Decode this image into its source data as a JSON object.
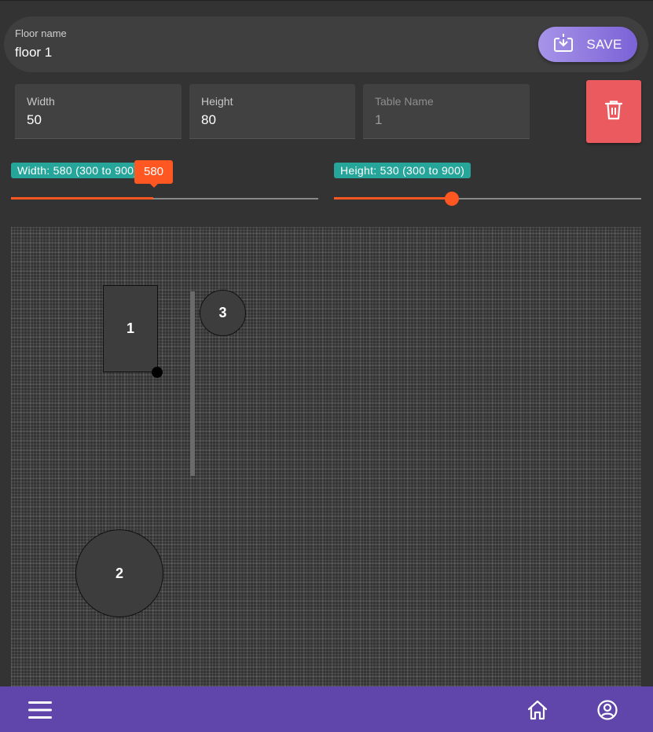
{
  "floor": {
    "label": "Floor name",
    "value": "floor 1"
  },
  "save_button": {
    "label": "SAVE",
    "icon": "download-save-icon"
  },
  "fields": {
    "width": {
      "label": "Width",
      "value": "50"
    },
    "height": {
      "label": "Height",
      "value": "80"
    },
    "table_name": {
      "label": "Table Name",
      "value": "1"
    }
  },
  "delete_button": {
    "icon": "trash-icon",
    "color": "#eb5a5f"
  },
  "sliders": {
    "width": {
      "badge": "Width: 580 (300 to 900)",
      "value": 580,
      "min": 300,
      "max": 900,
      "tooltip": "580"
    },
    "height": {
      "badge": "Height: 530 (300 to 900)",
      "value": 530,
      "min": 300,
      "max": 900
    }
  },
  "canvas": {
    "tables": [
      {
        "label": "1",
        "shape": "rectangle"
      },
      {
        "label": "2",
        "shape": "circle"
      },
      {
        "label": "3",
        "shape": "circle"
      }
    ],
    "wall": {
      "shape": "line"
    }
  },
  "nav": {
    "menu_icon": "hamburger-menu-icon",
    "home_icon": "home-icon",
    "profile_icon": "account-circle-icon"
  },
  "colors": {
    "accent": "#ff5722",
    "teal": "#26a69a",
    "nav": "#6045ab",
    "save": "#8a72df"
  }
}
